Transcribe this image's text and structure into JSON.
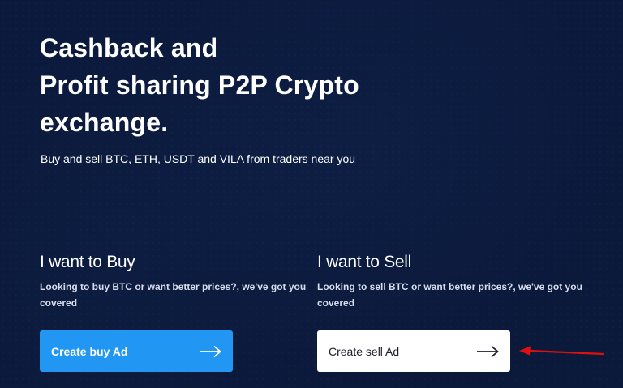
{
  "hero": {
    "title_lines": [
      "Cashback and",
      "Profit sharing P2P Crypto",
      "exchange."
    ],
    "subtitle": "Buy and sell BTC, ETH, USDT and VILA from traders near you"
  },
  "buy": {
    "heading": "I want to Buy",
    "description": "Looking to buy BTC or want better prices?, we've got you covered",
    "button_label": "Create buy Ad",
    "icon": "arrow-right-icon"
  },
  "sell": {
    "heading": "I want to Sell",
    "description": "Looking to sell BTC or want better prices?, we've got you covered",
    "button_label": "Create sell Ad",
    "icon": "arrow-right-icon"
  },
  "colors": {
    "background": "#0b1a3c",
    "buy_button": "#2196f3",
    "sell_button": "#ffffff",
    "annotation_arrow": "#e01010"
  }
}
